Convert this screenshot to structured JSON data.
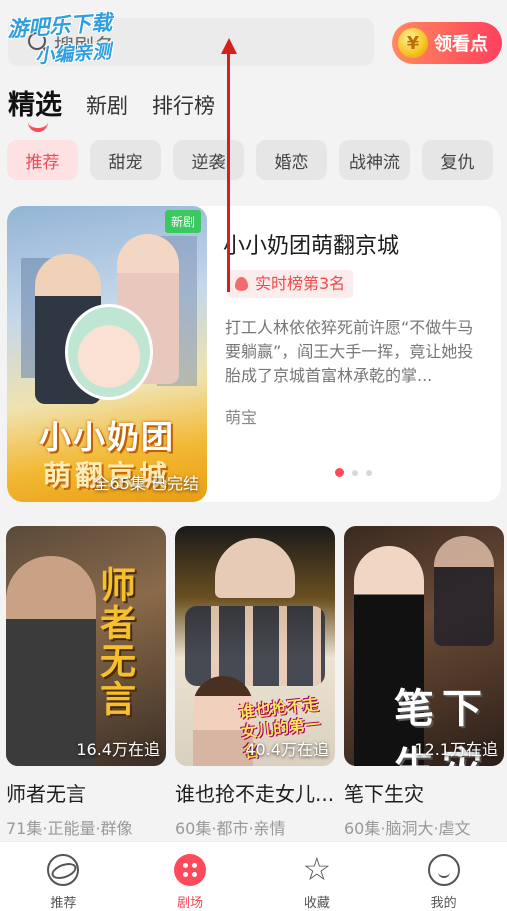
{
  "search": {
    "placeholder": "搜剧名"
  },
  "coins": {
    "label": "领看点",
    "icon": "yen-coin-icon"
  },
  "watermark": {
    "line1": "游吧乐下载",
    "line2": "小编亲测"
  },
  "tabs": [
    {
      "label": "精选",
      "active": true
    },
    {
      "label": "新剧",
      "active": false
    },
    {
      "label": "排行榜",
      "active": false
    }
  ],
  "chips": [
    {
      "label": "推荐",
      "active": true
    },
    {
      "label": "甜宠"
    },
    {
      "label": "逆袭"
    },
    {
      "label": "婚恋"
    },
    {
      "label": "战神流"
    },
    {
      "label": "复仇"
    }
  ],
  "featured": {
    "badge": "新剧",
    "poster_title_line1": "小小奶团",
    "poster_title_line2": "萌翻京城",
    "episodes": "全65集 已完结",
    "title": "小小奶团萌翻京城",
    "rank": "实时榜第3名",
    "description": "打工人林依依猝死前许愿“不做牛马要躺赢”，阎王大手一挥，竟让她投胎成了京城首富林承乾的掌...",
    "tag": "萌宝",
    "carousel": {
      "count": 3,
      "active_index": 0
    }
  },
  "dramas": [
    {
      "poster_text": "师者无言",
      "followers": "16.4万在追",
      "name": "师者无言",
      "meta": "71集·正能量·群像"
    },
    {
      "poster_text": "谁也抢不走女儿的第一名",
      "followers": "40.4万在追",
      "name": "谁也抢不走女儿...",
      "meta": "60集·都市·亲情"
    },
    {
      "poster_text": "笔下生灾",
      "followers": "12.1万在追",
      "name": "笔下生灾",
      "meta": "60集·脑洞大·虐文"
    }
  ],
  "nav": [
    {
      "label": "推荐",
      "icon": "planet-icon",
      "active": false
    },
    {
      "label": "剧场",
      "icon": "theater-dots-icon",
      "active": true
    },
    {
      "label": "收藏",
      "icon": "star-icon",
      "active": false
    },
    {
      "label": "我的",
      "icon": "smile-face-icon",
      "active": false
    }
  ],
  "colors": {
    "accent": "#ff4a5c",
    "chip_active_bg": "#fde1e3",
    "new_badge": "#3cc860",
    "annotation_arrow": "#d61f1f"
  }
}
